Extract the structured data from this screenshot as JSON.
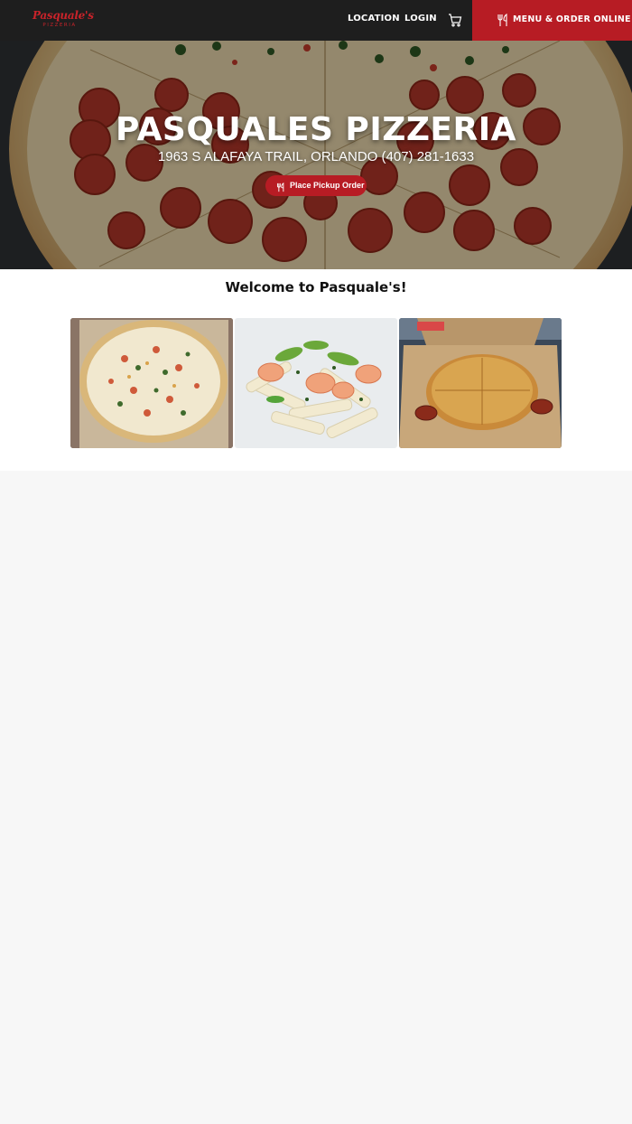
{
  "header": {
    "logo": {
      "script": "Pasquale's",
      "sub": "PIZZERIA"
    },
    "nav": {
      "location": "LOCATION",
      "login": "LOGIN"
    },
    "order_button": "MENU & ORDER ONLINE"
  },
  "hero": {
    "title": "PASQUALES PIZZERIA",
    "subtitle": "1963 S ALAFAYA TRAIL, ORLANDO (407) 281-1633",
    "pickup_button": "Place Pickup Order"
  },
  "welcome": {
    "title": "Welcome to Pasquale's!"
  },
  "colors": {
    "header_bg": "#1e1e1e",
    "brand_red": "#b71c24",
    "page_bg": "#f7f7f7"
  },
  "icons": [
    "shopping-cart-icon",
    "fork-knife-icon"
  ]
}
